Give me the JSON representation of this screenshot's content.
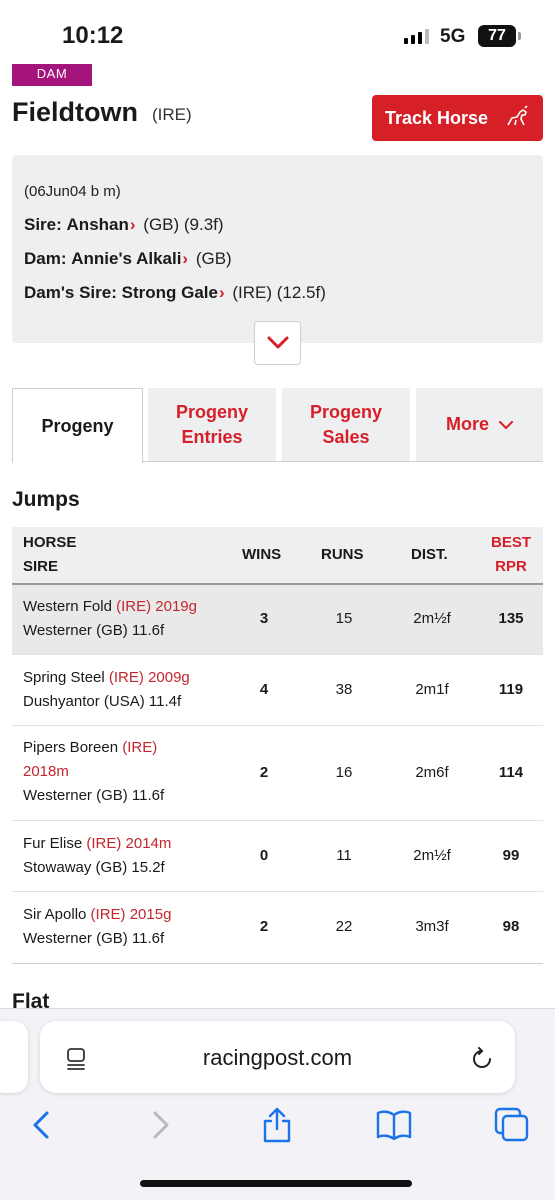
{
  "status": {
    "time": "10:12",
    "network": "5G",
    "battery": "77"
  },
  "header": {
    "badge": "DAM",
    "horse_name": "Fieldtown",
    "country": "(IRE)",
    "track_button": "Track Horse"
  },
  "pedigree": {
    "dob": "(06Jun04 b m)",
    "sire_label": "Sire:",
    "sire_name": "Anshan",
    "sire_extra": "(GB) (9.3f)",
    "dam_label": "Dam:",
    "dam_name": "Annie's Alkali",
    "dam_extra": "(GB)",
    "damsire_label": "Dam's Sire:",
    "damsire_name": "Strong Gale",
    "damsire_extra": "(IRE) (12.5f)"
  },
  "tabs": {
    "progeny": "Progeny",
    "entries_l1": "Progeny",
    "entries_l2": "Entries",
    "sales_l1": "Progeny",
    "sales_l2": "Sales",
    "more": "More"
  },
  "section_title": "Jumps",
  "table": {
    "col_horse": "HORSE",
    "col_sire": "SIRE",
    "col_wins": "WINS",
    "col_runs": "RUNS",
    "col_dist": "DIST.",
    "col_best": "BEST",
    "col_rpr": "RPR",
    "rows": [
      {
        "horse": "Western Fold",
        "country": "(IRE)",
        "info": "2019g",
        "sire": "Westerner (GB) 11.6f",
        "wins": "3",
        "runs": "15",
        "dist": "2m½f",
        "rpr": "135"
      },
      {
        "horse": "Spring Steel",
        "country": "(IRE)",
        "info": "2009g",
        "sire": "Dushyantor (USA) 11.4f",
        "wins": "4",
        "runs": "38",
        "dist": "2m1f",
        "rpr": "119"
      },
      {
        "horse": "Pipers Boreen",
        "country": "(IRE)",
        "info": "2018m",
        "sire": "Westerner (GB) 11.6f",
        "wins": "2",
        "runs": "16",
        "dist": "2m6f",
        "rpr": "114"
      },
      {
        "horse": "Fur Elise",
        "country": "(IRE)",
        "info": "2014m",
        "sire": "Stowaway (GB) 15.2f",
        "wins": "0",
        "runs": "11",
        "dist": "2m½f",
        "rpr": "99"
      },
      {
        "horse": "Sir Apollo",
        "country": "(IRE)",
        "info": "2015g",
        "sire": "Westerner (GB) 11.6f",
        "wins": "2",
        "runs": "22",
        "dist": "3m3f",
        "rpr": "98"
      }
    ]
  },
  "next_section": "Flat",
  "browser": {
    "url": "racingpost.com"
  },
  "colors": {
    "brand_red": "#d71f27",
    "dam_badge": "#a5147a",
    "panel_grey": "#eeeff1"
  }
}
